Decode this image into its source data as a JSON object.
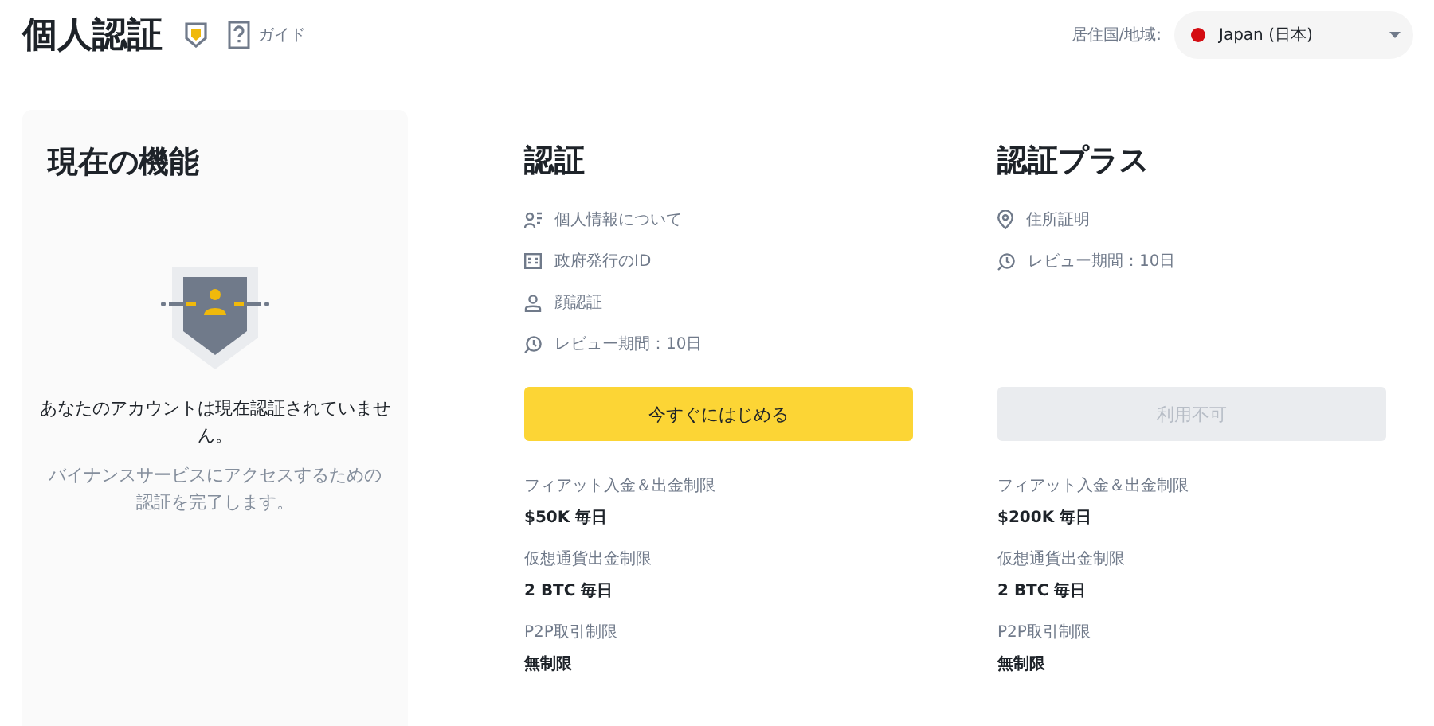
{
  "header": {
    "title": "個人認証",
    "guide_label": "ガイド",
    "residence_label": "居住国/地域:",
    "country": "Japan (日本)"
  },
  "current": {
    "title": "現在の機能",
    "status": "あなたのアカウントは現在認証されていません。",
    "hint": "バイナンスサービスにアクセスするための認証を完了します。"
  },
  "tiers": [
    {
      "title": "認証",
      "requirements": [
        {
          "kind": "person-info",
          "label": "個人情報について"
        },
        {
          "kind": "id-card",
          "label": "政府発行のID"
        },
        {
          "kind": "face",
          "label": "顔認証"
        },
        {
          "kind": "clock",
          "label": "レビュー期間：10日"
        }
      ],
      "button": {
        "label": "今すぐにはじめる",
        "disabled": false
      },
      "limits": [
        {
          "label": "フィアット入金＆出金制限",
          "value": "$50K 毎日"
        },
        {
          "label": "仮想通貨出金制限",
          "value": "2 BTC 毎日"
        },
        {
          "label": "P2P取引制限",
          "value": "無制限"
        }
      ]
    },
    {
      "title": "認証プラス",
      "requirements": [
        {
          "kind": "location",
          "label": "住所証明"
        },
        {
          "kind": "clock",
          "label": "レビュー期間：10日"
        }
      ],
      "button": {
        "label": "利用不可",
        "disabled": true
      },
      "limits": [
        {
          "label": "フィアット入金＆出金制限",
          "value": "$200K 毎日"
        },
        {
          "label": "仮想通貨出金制限",
          "value": "2 BTC 毎日"
        },
        {
          "label": "P2P取引制限",
          "value": "無制限"
        }
      ]
    }
  ]
}
